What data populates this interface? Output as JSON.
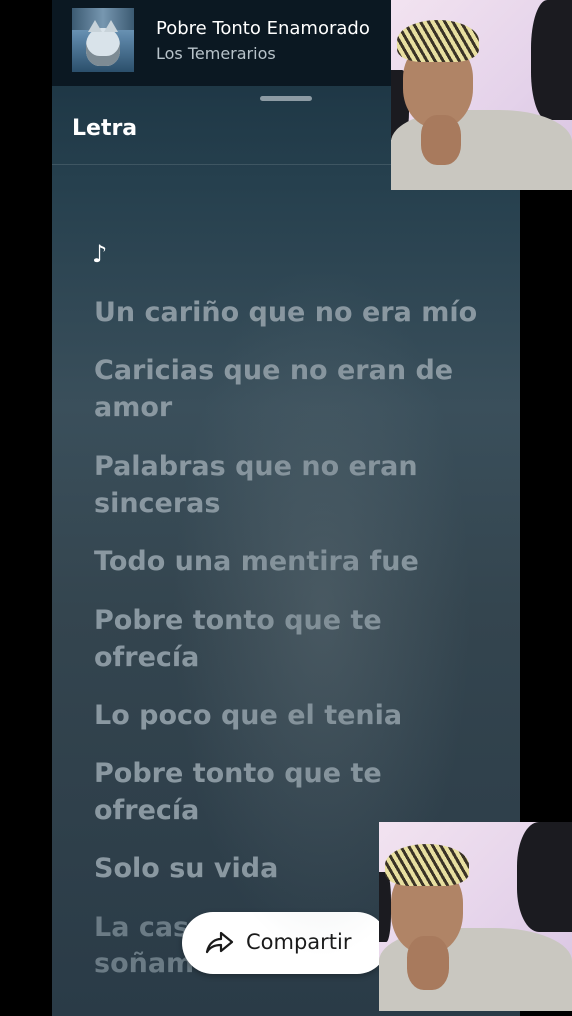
{
  "now_playing": {
    "title": "Pobre Tonto Enamorado",
    "artist": "Los Temerarios"
  },
  "section": {
    "title": "Letra"
  },
  "lyrics": {
    "note_symbol": "♪",
    "lines": [
      "Un cariño que no era mío",
      "Caricias que no eran de amor",
      "Palabras que no eran sinceras",
      "Todo una mentira fue",
      "Pobre tonto que te ofrecía",
      "Lo poco que el tenia",
      "Pobre tonto que te ofrecía",
      "Solo su vida",
      "La cas",
      "soñam"
    ]
  },
  "share": {
    "label": "Compartir",
    "icon": "share-arrow-icon"
  },
  "colors": {
    "accent": "#ffffff",
    "lyric_text": "#8a98a1"
  }
}
